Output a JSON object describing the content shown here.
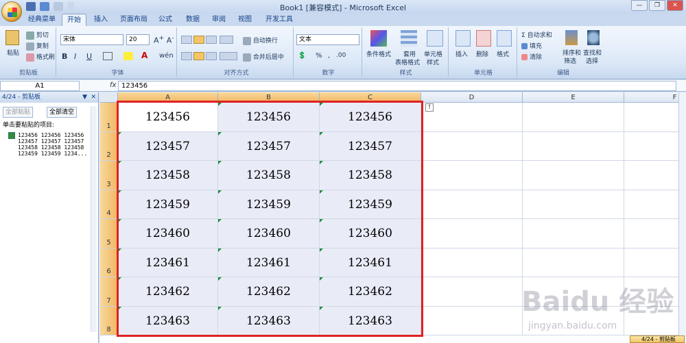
{
  "window": {
    "title": "Book1 [兼容模式] - Microsoft Excel",
    "min": "—",
    "max": "❐",
    "close": "✕"
  },
  "tabs": [
    "经典菜单",
    "开始",
    "插入",
    "页面布局",
    "公式",
    "数据",
    "审阅",
    "视图",
    "开发工具"
  ],
  "ribbon": {
    "clipboard": {
      "paste": "粘贴",
      "cut": "剪切",
      "copy": "复制",
      "format_painter": "格式刷",
      "label": "剪贴板"
    },
    "font": {
      "name": "宋体",
      "size": "20",
      "label": "字体"
    },
    "alignment": {
      "wrap": "自动换行",
      "merge": "合并后居中",
      "label": "对齐方式"
    },
    "number": {
      "format": "文本",
      "label": "数字"
    },
    "styles": {
      "cond": "条件格式",
      "table1": "套用",
      "table2": "表格格式",
      "cell1": "单元格",
      "cell2": "样式",
      "label": "样式"
    },
    "cells": {
      "insert": "插入",
      "delete": "删除",
      "format": "格式",
      "label": "单元格"
    },
    "editing": {
      "autosum": "自动求和",
      "fill": "填充",
      "clear": "清除",
      "sort1": "排序和",
      "sort2": "筛选",
      "find1": "查找和",
      "find2": "选择",
      "label": "编辑"
    }
  },
  "formula_bar": {
    "name_box": "A1",
    "fx": "fx",
    "content": "123456"
  },
  "clipboard_pane": {
    "title": "4/24 - 剪贴板",
    "paste_all": "全部粘贴",
    "clear_all": "全部清空",
    "instruction": "单击要粘贴的项目:",
    "item_lines": [
      "123456  123456  123456",
      "123457  123457  123457",
      "123458  123458  123458",
      "123459  123459  1234..."
    ]
  },
  "sheet": {
    "columns": [
      "A",
      "B",
      "C",
      "D",
      "E",
      "F"
    ],
    "rows": [
      {
        "num": "1",
        "cells": [
          "123456",
          "123456",
          "123456"
        ]
      },
      {
        "num": "2",
        "cells": [
          "123457",
          "123457",
          "123457"
        ]
      },
      {
        "num": "3",
        "cells": [
          "123458",
          "123458",
          "123458"
        ]
      },
      {
        "num": "4",
        "cells": [
          "123459",
          "123459",
          "123459"
        ]
      },
      {
        "num": "5",
        "cells": [
          "123460",
          "123460",
          "123460"
        ]
      },
      {
        "num": "6",
        "cells": [
          "123461",
          "123461",
          "123461"
        ]
      },
      {
        "num": "7",
        "cells": [
          "123462",
          "123462",
          "123462"
        ]
      },
      {
        "num": "8",
        "cells": [
          "123463",
          "123463",
          "123463"
        ]
      }
    ]
  },
  "status": {
    "clipboard_button": "4/24 - 剪贴板"
  },
  "watermark": {
    "brand": "Baidu 经验",
    "url": "jingyan.baidu.com"
  },
  "colors": {
    "selection_border": "#e02020",
    "selected_header": "#f1b665",
    "error_triangle": "#1e8c3a"
  }
}
